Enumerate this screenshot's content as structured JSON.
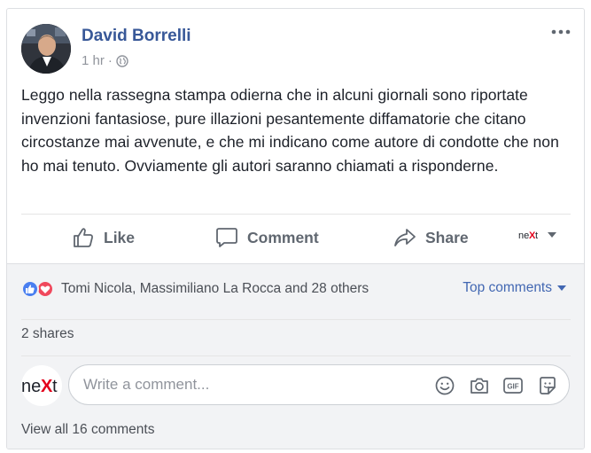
{
  "post": {
    "author": "David Borrelli",
    "time": "1 hr",
    "separator": "·",
    "text": "Leggo nella rassegna stampa odierna che in alcuni giornali sono riportate invenzioni fantasiose, pure illazioni pesantemente diffamatorie che citano circostanze mai avvenute, e che mi indicano come autore di condotte che non ho mai tenuto. Ovviamente gli autori saranno chiamati a risponderne."
  },
  "actions": {
    "like": "Like",
    "comment": "Comment",
    "share": "Share",
    "page_logo": "neXt"
  },
  "reactions": {
    "names": "Tomi Nicola, Massimiliano La Rocca and 28 others",
    "top_comments": "Top comments"
  },
  "shares": "2 shares",
  "comment_input": {
    "placeholder": "Write a comment...",
    "gif_label": "GIF",
    "avatar_logo": "neXt"
  },
  "view_all": "View all 16 comments",
  "colors": {
    "link": "#385898",
    "action_text": "#606770",
    "like_reaction": "#4a7ff0",
    "love_reaction": "#f0485c",
    "lower_bg": "#f2f3f5",
    "logo_red": "#e3001b"
  }
}
